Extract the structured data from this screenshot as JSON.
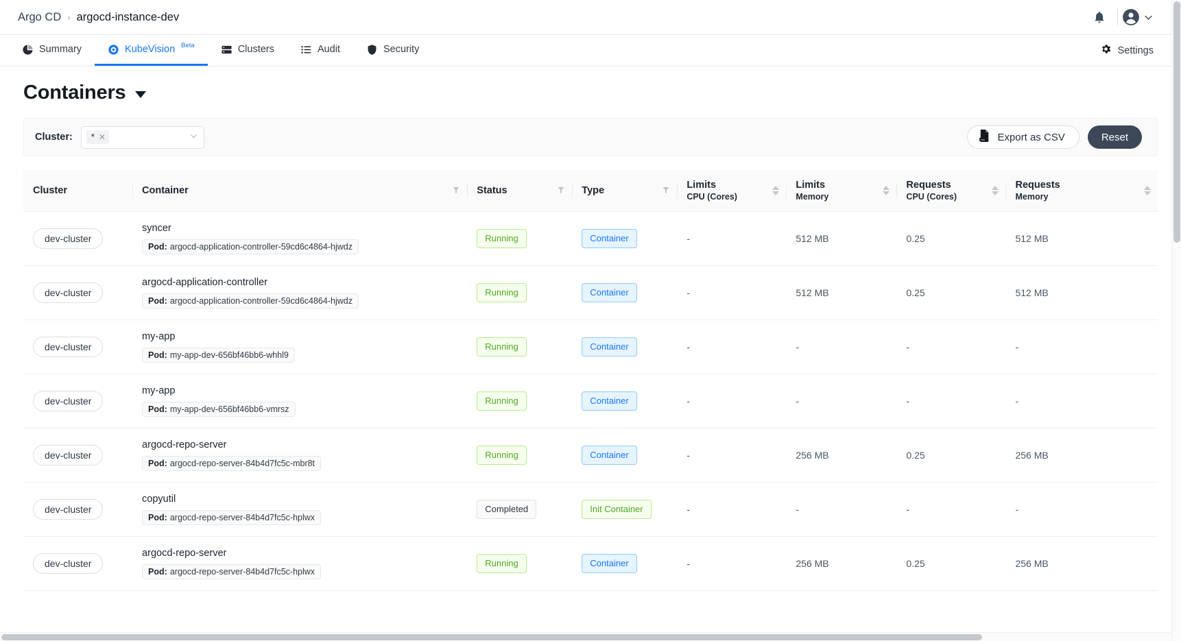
{
  "topbar": {
    "breadcrumb": {
      "root": "Argo CD",
      "separator": "›",
      "current": "argocd-instance-dev"
    },
    "notifications_icon": "bell-icon",
    "account_icon": "user-avatar-icon",
    "account_chevron": "chevron-down-icon"
  },
  "nav": {
    "tabs": [
      {
        "label": "Summary",
        "icon": "pie-chart-icon",
        "active": false,
        "badge": ""
      },
      {
        "label": "KubeVision",
        "icon": "eye-target-icon",
        "active": true,
        "badge": "Beta"
      },
      {
        "label": "Clusters",
        "icon": "server-stack-icon",
        "active": false,
        "badge": ""
      },
      {
        "label": "Audit",
        "icon": "list-icon",
        "active": false,
        "badge": ""
      },
      {
        "label": "Security",
        "icon": "shield-icon",
        "active": false,
        "badge": ""
      }
    ],
    "settings": {
      "label": "Settings",
      "icon": "gear-icon"
    }
  },
  "page": {
    "title": "Containers",
    "title_dropdown_icon": "caret-down-icon"
  },
  "filters": {
    "cluster_label": "Cluster:",
    "cluster_value_tag": "*",
    "cluster_tag_remove_icon": "close-x-icon",
    "cluster_dropdown_icon": "chevron-down-icon",
    "export_button": {
      "label": "Export as CSV",
      "icon": "csv-file-icon"
    },
    "reset_button": {
      "label": "Reset"
    }
  },
  "table": {
    "columns": [
      {
        "key": "cluster",
        "label": "Cluster",
        "sub": "",
        "filterable": false,
        "sortable": false
      },
      {
        "key": "container",
        "label": "Container",
        "sub": "",
        "filterable": true,
        "sortable": false
      },
      {
        "key": "status",
        "label": "Status",
        "sub": "",
        "filterable": true,
        "sortable": false
      },
      {
        "key": "type",
        "label": "Type",
        "sub": "",
        "filterable": true,
        "sortable": false
      },
      {
        "key": "limits_cpu",
        "label": "Limits",
        "sub": "CPU (Cores)",
        "filterable": false,
        "sortable": true
      },
      {
        "key": "limits_mem",
        "label": "Limits",
        "sub": "Memory",
        "filterable": false,
        "sortable": true
      },
      {
        "key": "requests_cpu",
        "label": "Requests",
        "sub": "CPU (Cores)",
        "filterable": false,
        "sortable": true
      },
      {
        "key": "requests_mem",
        "label": "Requests",
        "sub": "Memory",
        "filterable": false,
        "sortable": true
      }
    ],
    "pod_prefix": "Pod",
    "rows": [
      {
        "cluster": "dev-cluster",
        "container": "syncer",
        "pod": "argocd-application-controller-59cd6c4864-hjwdz",
        "status": "Running",
        "status_style": "running",
        "type": "Container",
        "type_style": "container",
        "limits_cpu": "-",
        "limits_mem": "512 MB",
        "requests_cpu": "0.25",
        "requests_mem": "512 MB"
      },
      {
        "cluster": "dev-cluster",
        "container": "argocd-application-controller",
        "pod": "argocd-application-controller-59cd6c4864-hjwdz",
        "status": "Running",
        "status_style": "running",
        "type": "Container",
        "type_style": "container",
        "limits_cpu": "-",
        "limits_mem": "512 MB",
        "requests_cpu": "0.25",
        "requests_mem": "512 MB"
      },
      {
        "cluster": "dev-cluster",
        "container": "my-app",
        "pod": "my-app-dev-656bf46bb6-whhl9",
        "status": "Running",
        "status_style": "running",
        "type": "Container",
        "type_style": "container",
        "limits_cpu": "-",
        "limits_mem": "-",
        "requests_cpu": "-",
        "requests_mem": "-"
      },
      {
        "cluster": "dev-cluster",
        "container": "my-app",
        "pod": "my-app-dev-656bf46bb6-vmrsz",
        "status": "Running",
        "status_style": "running",
        "type": "Container",
        "type_style": "container",
        "limits_cpu": "-",
        "limits_mem": "-",
        "requests_cpu": "-",
        "requests_mem": "-"
      },
      {
        "cluster": "dev-cluster",
        "container": "argocd-repo-server",
        "pod": "argocd-repo-server-84b4d7fc5c-mbr8t",
        "status": "Running",
        "status_style": "running",
        "type": "Container",
        "type_style": "container",
        "limits_cpu": "-",
        "limits_mem": "256 MB",
        "requests_cpu": "0.25",
        "requests_mem": "256 MB"
      },
      {
        "cluster": "dev-cluster",
        "container": "copyutil",
        "pod": "argocd-repo-server-84b4d7fc5c-hplwx",
        "status": "Completed",
        "status_style": "completed",
        "type": "Init Container",
        "type_style": "initcontainer",
        "limits_cpu": "-",
        "limits_mem": "-",
        "requests_cpu": "-",
        "requests_mem": "-"
      },
      {
        "cluster": "dev-cluster",
        "container": "argocd-repo-server",
        "pod": "argocd-repo-server-84b4d7fc5c-hplwx",
        "status": "Running",
        "status_style": "running",
        "type": "Container",
        "type_style": "container",
        "limits_cpu": "-",
        "limits_mem": "256 MB",
        "requests_cpu": "0.25",
        "requests_mem": "256 MB"
      }
    ]
  },
  "colors": {
    "accent_blue": "#1877f2",
    "tag_blue_bg": "#e6f4ff",
    "tag_blue_text": "#1677ff",
    "tag_green_bg": "#f6ffed",
    "tag_green_text": "#52a526",
    "dark_button": "#3c4858"
  }
}
